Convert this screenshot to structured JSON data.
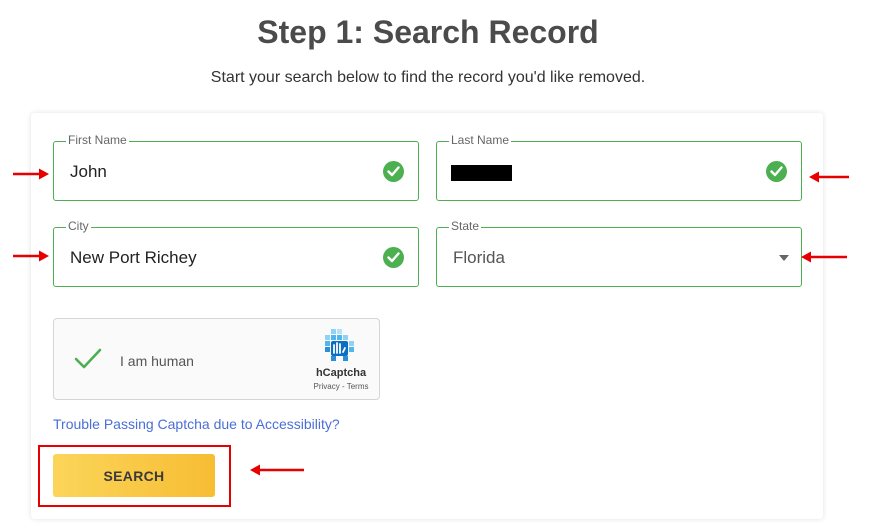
{
  "page": {
    "title": "Step 1: Search Record",
    "subtitle": "Start your search below to find the record you'd like removed."
  },
  "form": {
    "first_name": {
      "label": "First Name",
      "value": "John",
      "valid": true
    },
    "last_name": {
      "label": "Last Name",
      "value": "",
      "redacted": true,
      "valid": true
    },
    "city": {
      "label": "City",
      "value": "New Port Richey",
      "valid": true
    },
    "state": {
      "label": "State",
      "value": "Florida"
    }
  },
  "captcha": {
    "label": "I am human",
    "brand": "hCaptcha",
    "privacy": "Privacy",
    "separator": " - ",
    "terms": "Terms"
  },
  "trouble_link": "Trouble Passing Captcha due to Accessibility?",
  "search_button": "SEARCH",
  "colors": {
    "valid_green": "#4caf50",
    "annotation_red": "#e60000",
    "button_yellow": "#f7bd33",
    "link_blue": "#4a6fd6"
  },
  "icons": [
    "check-circle-icon",
    "caret-down-icon",
    "checkmark-icon",
    "hcaptcha-logo-icon",
    "annotation-arrow-icon"
  ]
}
